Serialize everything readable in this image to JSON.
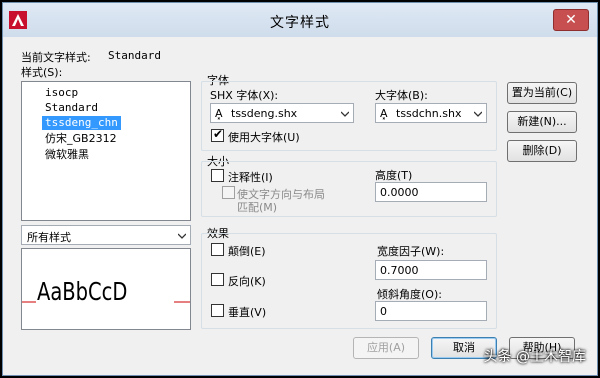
{
  "title": "文字样式",
  "close_glyph": "✕",
  "current_style_label": "当前文字样式:",
  "current_style_value": "Standard",
  "styles_label": "样式(S):",
  "styles": [
    "isocp",
    "Standard",
    "tssdeng_chn",
    "仿宋_GB2312",
    "微软雅黑"
  ],
  "selected_style": "tssdeng_chn",
  "filter_combo": "所有样式",
  "preview_text": "AaBbCcD",
  "font_group": {
    "title": "字体",
    "shx_label": "SHX 字体(X):",
    "shx_value": "tssdeng.shx",
    "bigfont_label": "大字体(B):",
    "bigfont_value": "tssdchn.shx",
    "use_bigfont_label": "使用大字体(U)",
    "use_bigfont_checked": true
  },
  "size_group": {
    "title": "大小",
    "annotative_label": "注释性(I)",
    "match_orientation_line1": "使文字方向与布局",
    "match_orientation_line2": "匹配(M)",
    "height_label": "高度(T)",
    "height_value": "0.0000"
  },
  "effects_group": {
    "title": "效果",
    "upside_down_label": "颠倒(E)",
    "backwards_label": "反向(K)",
    "vertical_label": "垂直(V)",
    "width_factor_label": "宽度因子(W):",
    "width_factor_value": "0.7000",
    "oblique_label": "倾斜角度(O):",
    "oblique_value": "0"
  },
  "buttons": {
    "set_current": "置为当前(C)",
    "new": "新建(N)...",
    "delete": "删除(D)",
    "apply": "应用(A)",
    "cancel": "取消",
    "help": "帮助(H)"
  },
  "watermark": "头条 @土木智库",
  "colors": {
    "selection": "#3399ff",
    "close": "#c74f4f",
    "preview_line": "#cc0000"
  }
}
